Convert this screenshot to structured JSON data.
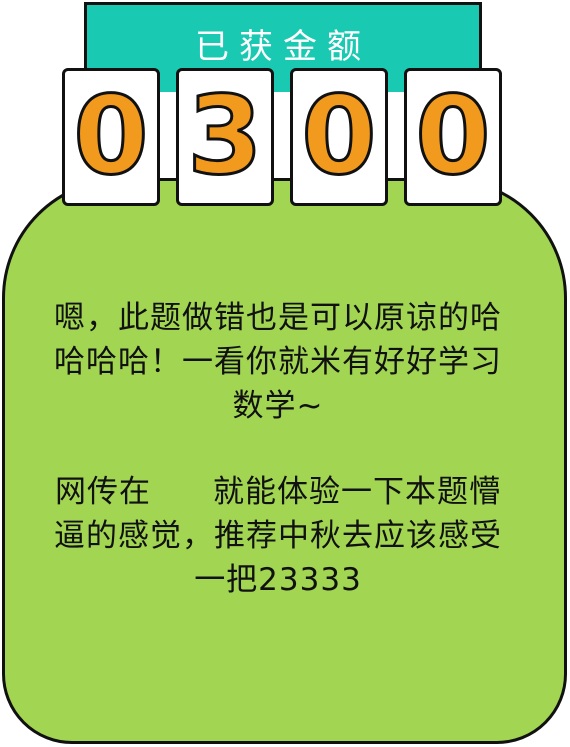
{
  "banner": {
    "title": "已获金额"
  },
  "amount": {
    "digits": [
      "0",
      "3",
      "0",
      "0"
    ]
  },
  "message": {
    "line1": "嗯，此题做错也是可以原谅的哈",
    "line2": "哈哈哈！一看你就米有好好学习",
    "line3": "数学~",
    "line4_before": "网传在",
    "line4_after": "就能体验一下本题懵",
    "line5": "逼的感觉，推荐中秋去应该感受",
    "line6": "一把23333"
  },
  "colors": {
    "banner": "#19c9b2",
    "jar": "#a1d552",
    "digit": "#f29a1e"
  }
}
